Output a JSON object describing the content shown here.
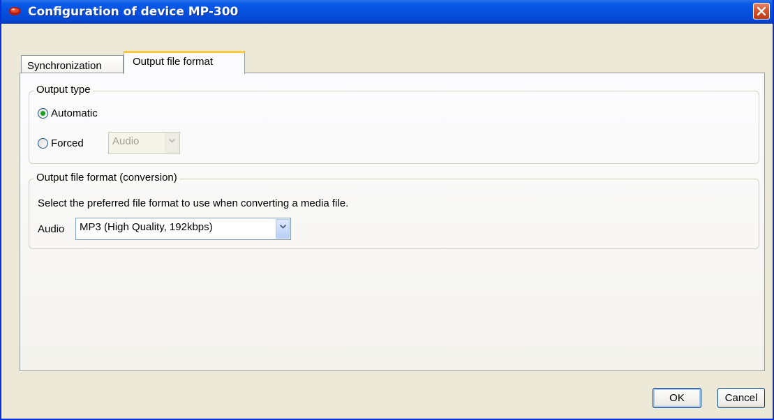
{
  "window": {
    "title": "Configuration of device MP-300",
    "icon": "app-icon",
    "close_icon": "close-icon"
  },
  "tabs": [
    {
      "label": "Synchronization",
      "selected": false
    },
    {
      "label": "Output file format",
      "selected": true
    }
  ],
  "output_type": {
    "legend": "Output type",
    "options": [
      {
        "label": "Automatic",
        "checked": true
      },
      {
        "label": "Forced",
        "checked": false
      }
    ],
    "forced_select": {
      "value": "Audio",
      "enabled": false
    }
  },
  "conversion": {
    "legend": "Output file format (conversion)",
    "description": "Select the preferred file format to use when converting a media file.",
    "audio_label": "Audio",
    "audio_select": {
      "value": "MP3 (High Quality, 192kbps)"
    }
  },
  "buttons": {
    "ok": "OK",
    "cancel": "Cancel"
  },
  "colors": {
    "titlebar": "#0a5ce8",
    "tab_highlight": "#ffc83c",
    "radio_checked": "#21a121"
  }
}
